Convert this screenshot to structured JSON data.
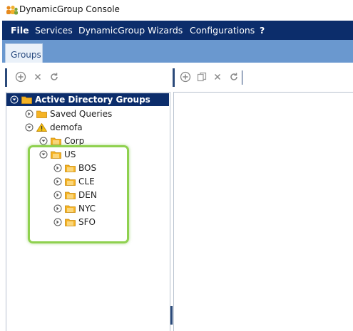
{
  "window": {
    "title": "DynamicGroup Console"
  },
  "menu": {
    "items": [
      {
        "label": "File"
      },
      {
        "label": "Services"
      },
      {
        "label": "DynamicGroup Wizards"
      },
      {
        "label": "Configurations"
      },
      {
        "label": "?"
      }
    ]
  },
  "tabs": [
    {
      "label": "Groups"
    }
  ],
  "toolbar_left": {
    "icons": [
      "add-icon",
      "delete-icon",
      "refresh-icon"
    ]
  },
  "toolbar_right": {
    "icons": [
      "add-icon",
      "copy-icon",
      "delete-icon",
      "refresh-icon"
    ]
  },
  "tree": {
    "nodes": [
      {
        "label": "Active Directory Groups",
        "icon": "folder-icon",
        "expanded": true,
        "selected": true
      },
      {
        "label": "Saved Queries",
        "icon": "folder-icon",
        "expanded": false
      },
      {
        "label": "demofa",
        "icon": "warning-icon",
        "expanded": true
      },
      {
        "label": "Corp",
        "icon": "folder-icon",
        "expanded": true
      },
      {
        "label": "US",
        "icon": "folder-icon",
        "expanded": true
      },
      {
        "label": "BOS",
        "icon": "folder-icon",
        "expanded": false
      },
      {
        "label": "CLE",
        "icon": "folder-icon",
        "expanded": false
      },
      {
        "label": "DEN",
        "icon": "folder-icon",
        "expanded": false
      },
      {
        "label": "NYC",
        "icon": "folder-icon",
        "expanded": false
      },
      {
        "label": "SFO",
        "icon": "folder-icon",
        "expanded": false
      }
    ]
  },
  "colors": {
    "menubar": "#0c2d6b",
    "tabstrip": "#6a98cf",
    "selection": "#0c2d6b",
    "highlight": "#8fd14f",
    "folder": "#f5b324"
  }
}
